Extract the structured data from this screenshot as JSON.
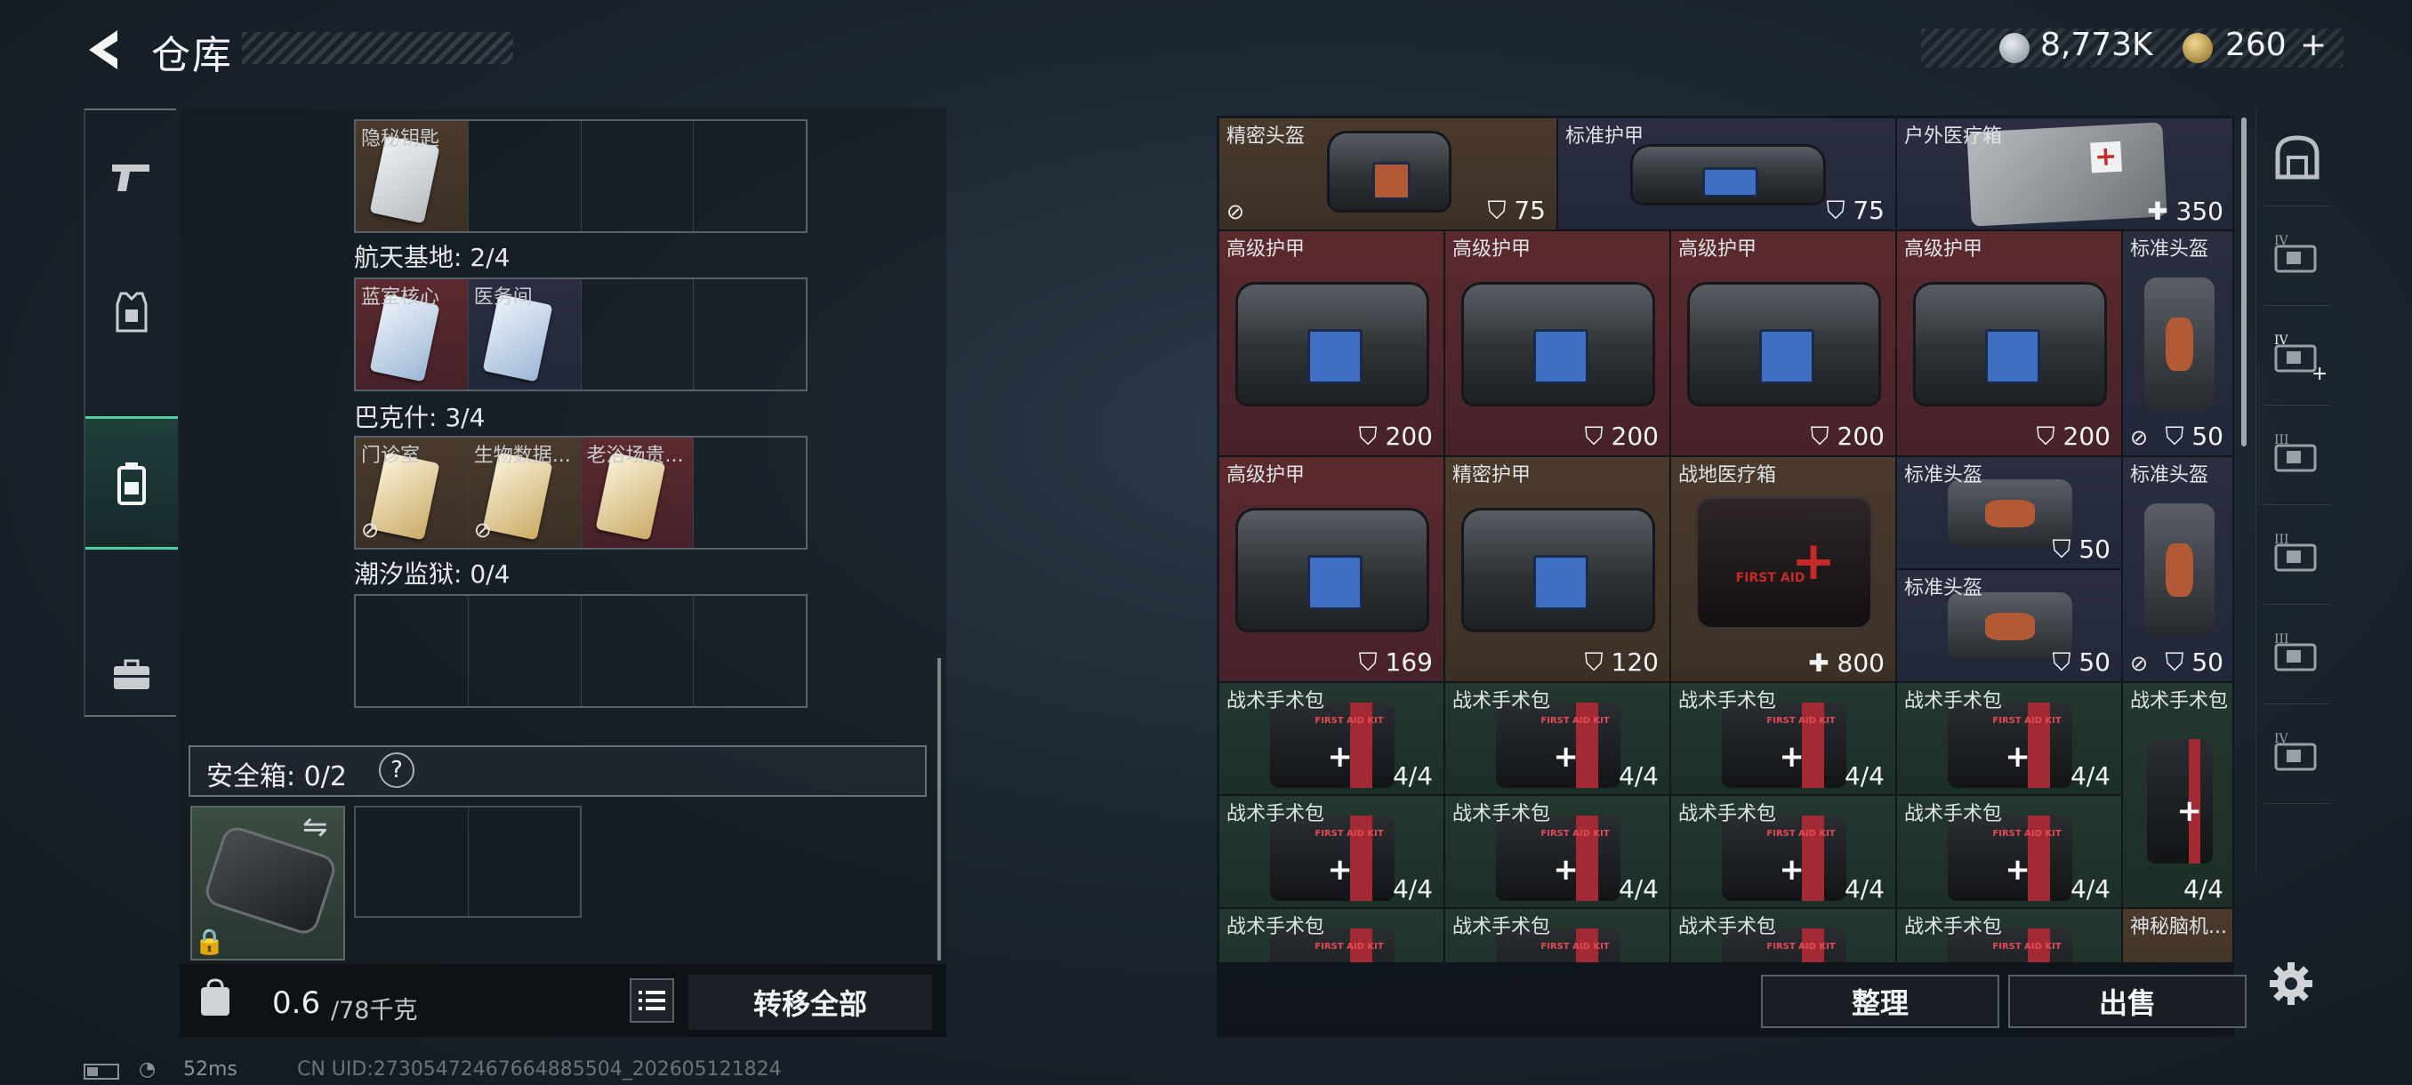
{
  "header": {
    "title": "仓库",
    "currency_silver": "8,773K",
    "currency_gold": "260",
    "currency_gold_suffix": "+"
  },
  "left_nav": [
    "pistol-icon",
    "armor-vest-icon",
    "backpack-icon",
    "briefcase-icon"
  ],
  "left_panel": {
    "secret_key_label": "隐秘钥匙",
    "sections": [
      {
        "title": "航天基地: 2/4",
        "items": [
          "蓝室核心",
          "医务间"
        ]
      },
      {
        "title": "巴克什: 3/4",
        "items": [
          "门诊室",
          "生物数据...",
          "老浴场贵..."
        ]
      },
      {
        "title": "潮汐监狱: 0/4",
        "items": []
      }
    ],
    "safe_box_label": "安全箱: 0/2",
    "safe_box_help": "?",
    "weight_value": "0.6",
    "weight_unit": "/78千克",
    "transfer_all": "转移全部"
  },
  "grid": {
    "items": [
      {
        "name": "精密头盔",
        "value": "75",
        "color": "brown",
        "icon": "helmet-bag"
      },
      {
        "name": "标准护甲",
        "value": "75",
        "color": "navy",
        "icon": "armor"
      },
      {
        "name": "户外医疗箱",
        "value": "350",
        "color": "navy",
        "icon": "outdoor-medkit"
      },
      {
        "name": "高级护甲",
        "value": "200"
      },
      {
        "name": "高级护甲",
        "value": "200"
      },
      {
        "name": "高级护甲",
        "value": "200"
      },
      {
        "name": "高级护甲",
        "value": "200"
      },
      {
        "name": "标准头盔",
        "value": "50"
      },
      {
        "name": "高级护甲",
        "value": "169"
      },
      {
        "name": "精密护甲",
        "value": "120"
      },
      {
        "name": "战地医疗箱",
        "value": "800"
      },
      {
        "name": "标准头盔",
        "value": "50"
      },
      {
        "name": "标准头盔",
        "value": "50"
      },
      {
        "name": "标准头盔",
        "value": "50"
      },
      {
        "name": "战术手术包",
        "value": "4/4"
      },
      {
        "name": "战术手术包",
        "value": "4/4"
      },
      {
        "name": "战术手术包",
        "value": "4/4"
      },
      {
        "name": "战术手术包",
        "value": "4/4"
      },
      {
        "name": "战术手术包",
        "value": "4/4"
      },
      {
        "name": "战术手术包",
        "value": "4/4"
      },
      {
        "name": "战术手术包",
        "value": "4/4"
      },
      {
        "name": "战术手术包",
        "value": "4/4"
      },
      {
        "name": "战术手术包",
        "value": "4/4"
      },
      {
        "name": "战术手术包",
        "value": ""
      },
      {
        "name": "战术手术包",
        "value": ""
      },
      {
        "name": "战术手术包",
        "value": ""
      },
      {
        "name": "战术手术包",
        "value": ""
      },
      {
        "name": "神秘脑机...",
        "value": ""
      }
    ],
    "kit_print": "FIRST AID KIT",
    "medkit_print": "FIRST AID"
  },
  "right_nav": [
    "helmet-filter-icon",
    "armor-IV-icon",
    "armor-IV-plus-icon",
    "armor-III-icon",
    "armor-III-b-icon",
    "armor-III-c-icon",
    "armor-IV-b-icon"
  ],
  "right_nav_labels": [
    "IV",
    "IV",
    "III",
    "III",
    "III",
    "IV"
  ],
  "buttons": {
    "sort": "整理",
    "sell": "出售"
  },
  "status": {
    "ping": "52ms",
    "uid": "CN UID:27305472467664885504_202605121824"
  }
}
